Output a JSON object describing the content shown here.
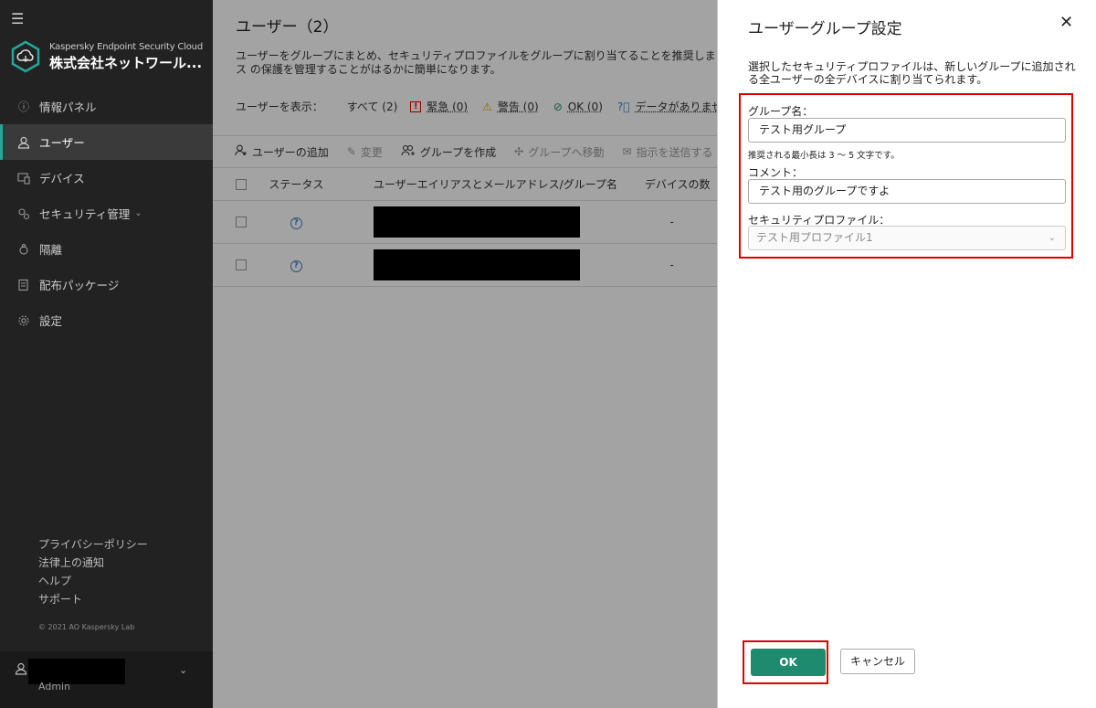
{
  "sidebar": {
    "product": "Kaspersky Endpoint Security Cloud",
    "company": "株式会社ネットワール...",
    "items": [
      {
        "label": "情報パネル",
        "icon": "info-icon"
      },
      {
        "label": "ユーザー",
        "icon": "user-icon",
        "active": true
      },
      {
        "label": "デバイス",
        "icon": "device-icon"
      },
      {
        "label": "セキュリティ管理",
        "icon": "security-icon",
        "has_submenu": true
      },
      {
        "label": "隔離",
        "icon": "quarantine-icon"
      },
      {
        "label": "配布パッケージ",
        "icon": "package-icon"
      },
      {
        "label": "設定",
        "icon": "gear-icon"
      }
    ],
    "footer_links": [
      "プライバシーポリシー",
      "法律上の通知",
      "ヘルプ",
      "サポート"
    ],
    "copyright": "© 2021 AO Kaspersky Lab",
    "user_role": "Admin"
  },
  "main": {
    "title": "ユーザー（2）",
    "description": "ユーザーをグループにまとめ、セキュリティプロファイルをグループに割り当てることを推奨します。ス の保護を管理することがはるかに簡単になります。",
    "filter_label": "ユーザーを表示：",
    "filter_all": "すべて (2)",
    "filters": [
      {
        "label": "緊急 (0)",
        "icon": "critical-icon",
        "color": "#e00000"
      },
      {
        "label": "警告 (0)",
        "icon": "warning-icon",
        "color": "#e0a800"
      },
      {
        "label": "OK (0)",
        "icon": "ok-icon",
        "color": "#1e8a6e"
      },
      {
        "label": "データがありませ",
        "icon": "question-icon",
        "color": "#3a7fc1"
      }
    ],
    "toolbar": {
      "add_user": "ユーザーの追加",
      "edit": "変更",
      "create_group": "グループを作成",
      "move_to_group": "グループへ移動",
      "send_instruction": "指示を送信する"
    },
    "columns": {
      "status": "ステータス",
      "name": "ユーザーエイリアスとメールアドレス/グループ名",
      "devices": "デバイスの数"
    },
    "rows": [
      {
        "devices": "-"
      },
      {
        "devices": "-"
      }
    ]
  },
  "dialog": {
    "title": "ユーザーグループ設定",
    "description": "選択したセキュリティプロファイルは、新しいグループに追加される全ユーザーの全デバイスに割り当てられます。",
    "group_name_label": "グループ名：",
    "group_name_value": "テスト用グループ",
    "group_name_hint": "推奨される最小長は 3 ～ 5 文字です。",
    "comment_label": "コメント：",
    "comment_value": "テスト用のグループですよ",
    "profile_label": "セキュリティプロファイル：",
    "profile_value": "テスト用プロファイル1",
    "ok_label": "OK",
    "cancel_label": "キャンセル"
  },
  "colors": {
    "accent": "#1e8a6e",
    "highlight": "#e00000",
    "sidebar_bg": "#222222"
  }
}
